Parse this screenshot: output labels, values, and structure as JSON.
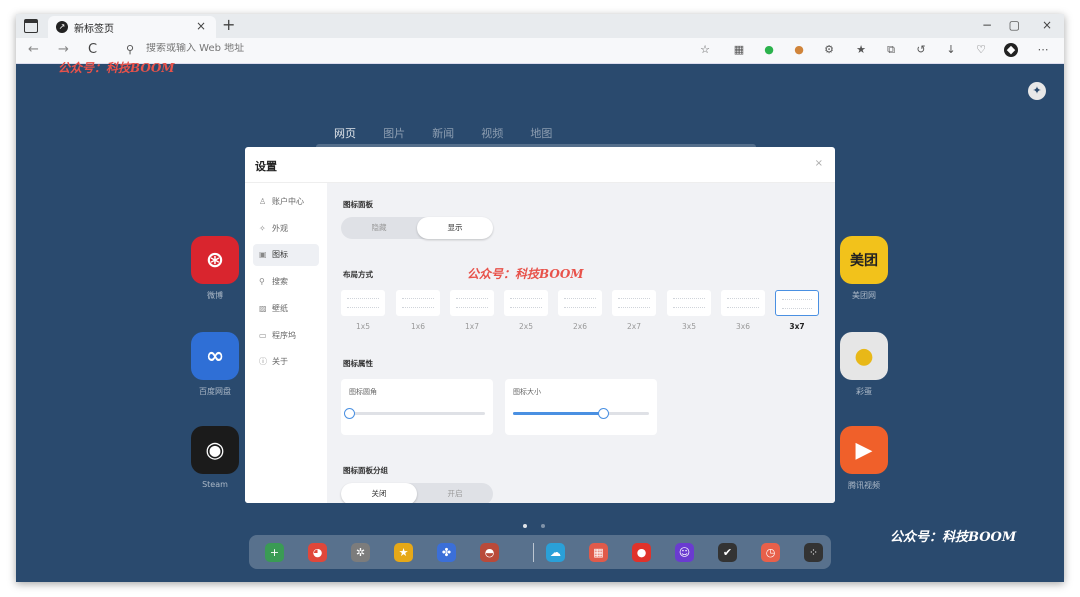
{
  "browser": {
    "tab_title": "新标签页",
    "tab_close": "×",
    "new_tab": "+",
    "address_placeholder": "搜索或输入 Web 地址",
    "nav": {
      "back": "←",
      "forward": "→",
      "refresh": "C"
    },
    "window_controls": {
      "minimize": "−",
      "restore": "▢",
      "close": "×"
    }
  },
  "watermarks": {
    "top_left": "公众号：科技BOOM",
    "dialog": "公众号：科技BOOM",
    "bottom_right": "公众号：科技BOOM"
  },
  "search_tabs": [
    "网页",
    "图片",
    "新闻",
    "视频",
    "地图"
  ],
  "apps_left": [
    {
      "label": "微博",
      "color": "#d9252e",
      "icon": "weibo-icon"
    },
    {
      "label": "百度网盘",
      "color": "#2f6fd6",
      "icon": "baidu-netdisk-icon"
    },
    {
      "label": "Steam",
      "color": "#1b1b1b",
      "icon": "steam-icon"
    }
  ],
  "apps_right": [
    {
      "label": "美团网",
      "icon_text": "美团",
      "color": "#f2c21b",
      "icon": "meituan-icon"
    },
    {
      "label": "彩蛋",
      "color": "#e6e6e6",
      "icon": "chick-icon"
    },
    {
      "label": "腾讯视频",
      "color": "#f0602a",
      "icon": "tencent-video-icon"
    }
  ],
  "settings": {
    "title": "设置",
    "close": "×",
    "sidebar": [
      {
        "label": "账户中心",
        "icon": "user-icon"
      },
      {
        "label": "外观",
        "icon": "appearance-icon"
      },
      {
        "label": "图标",
        "icon": "icon-grid-icon"
      },
      {
        "label": "搜索",
        "icon": "search-icon"
      },
      {
        "label": "壁纸",
        "icon": "wallpaper-icon"
      },
      {
        "label": "程序坞",
        "icon": "dock-icon"
      },
      {
        "label": "关于",
        "icon": "info-icon"
      }
    ],
    "active_item": "图标",
    "icon_panel": {
      "title": "图标面板",
      "options": [
        "隐藏",
        "显示"
      ],
      "selected": "显示"
    },
    "layout": {
      "title": "布局方式",
      "options": [
        "1x5",
        "1x6",
        "1x7",
        "2x5",
        "2x6",
        "2x7",
        "3x5",
        "3x6",
        "3x7"
      ],
      "selected": "3x7"
    },
    "icon_props": {
      "title": "图标属性",
      "radius_label": "图标圆角",
      "radius_value": 0.0,
      "size_label": "图标大小",
      "size_value": 0.66
    },
    "icon_grouping": {
      "title": "图标面板分组",
      "options": [
        "关闭",
        "开启"
      ],
      "selected": "关闭"
    }
  },
  "pager": {
    "pages": 2,
    "current": 1
  },
  "dock": [
    {
      "icon": "add-icon",
      "color": "#3a9b54"
    },
    {
      "icon": "game-icon",
      "color": "#e0473a"
    },
    {
      "icon": "settings-icon",
      "color": "#7c7c7c"
    },
    {
      "icon": "star-icon",
      "color": "#e6a817"
    },
    {
      "icon": "puzzle-icon",
      "color": "#3b6fd8"
    },
    {
      "icon": "wallpaper-app-icon",
      "color": "#b94a3a"
    },
    {
      "icon": "cloud-icon",
      "color": "#2aa0d8"
    },
    {
      "icon": "calendar-icon",
      "color": "#e05a4a"
    },
    {
      "icon": "bag-icon",
      "color": "#e0322a"
    },
    {
      "icon": "game-controller-icon",
      "color": "#6a3bd0"
    },
    {
      "icon": "checkmark-app-icon",
      "color": "#333333"
    },
    {
      "icon": "timer-icon",
      "color": "#e8604a"
    },
    {
      "icon": "apps-icon",
      "color": "#333333"
    }
  ]
}
